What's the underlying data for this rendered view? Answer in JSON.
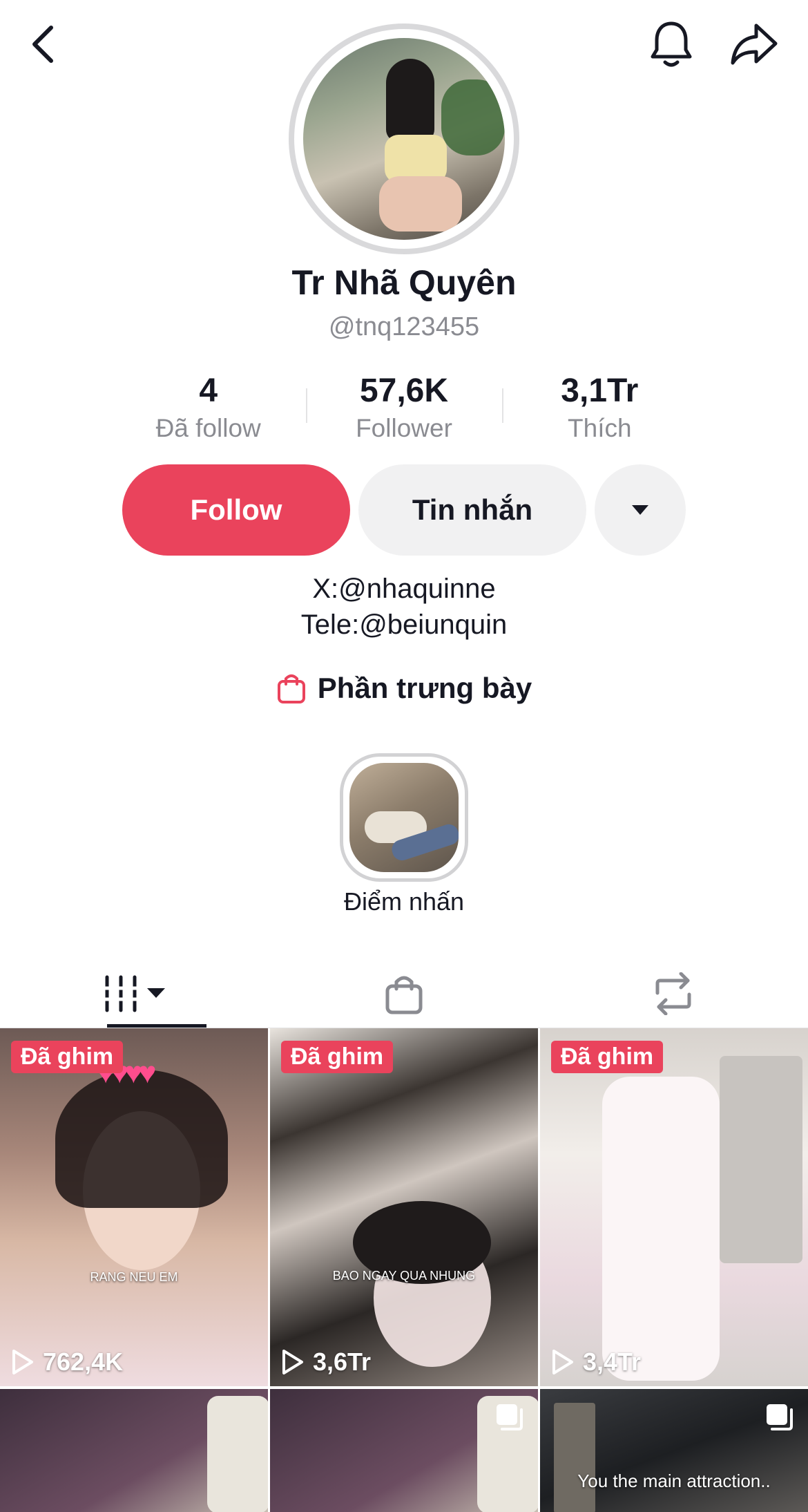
{
  "profile": {
    "name": "Tr Nhã Quyên",
    "handle": "@tnq123455"
  },
  "stats": [
    {
      "value": "4",
      "label": "Đã follow"
    },
    {
      "value": "57,6K",
      "label": "Follower"
    },
    {
      "value": "3,1Tr",
      "label": "Thích"
    }
  ],
  "actions": {
    "follow_label": "Follow",
    "message_label": "Tin nhắn"
  },
  "bio": {
    "line1": "X:@nhaquinne",
    "line2": "Tele:@beiunquin"
  },
  "showcase": {
    "label": "Phần trưng bày"
  },
  "highlight": {
    "label": "Điểm nhấn"
  },
  "videos": [
    {
      "pinned_label": "Đã ghim",
      "views": "762,4K",
      "overlay_text": "RANG NEU EM"
    },
    {
      "pinned_label": "Đã ghim",
      "views": "3,6Tr",
      "overlay_text": "BAO NGAY QUA NHUNG"
    },
    {
      "pinned_label": "Đã ghim",
      "views": "3,4Tr"
    },
    {},
    {},
    {
      "caption": "You the main attraction.."
    }
  ],
  "colors": {
    "accent": "#ea435c",
    "text_primary": "#161823",
    "text_secondary": "#8a8b91",
    "button_secondary": "#f1f1f2"
  },
  "icons": {
    "back": "chevron-left-icon",
    "notifications": "bell-icon",
    "share": "share-arrow-icon",
    "more": "caret-down-icon",
    "showcase": "shopping-bag-icon",
    "tab_videos": "grid-columns-icon",
    "tab_shop": "shopping-bag-icon",
    "tab_reposts": "repost-icon",
    "play": "play-icon",
    "multi_photo": "multi-photo-icon"
  }
}
